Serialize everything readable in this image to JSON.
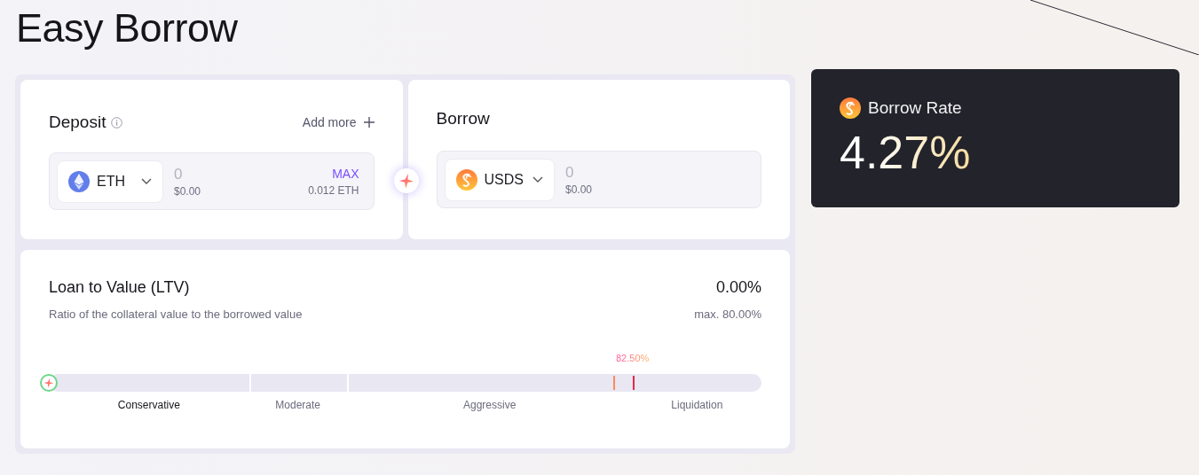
{
  "page": {
    "title": "Easy Borrow"
  },
  "deposit": {
    "title": "Deposit",
    "add_more": "Add more",
    "token": {
      "symbol": "ETH",
      "kind": "eth"
    },
    "amount": {
      "placeholder": "0"
    },
    "usd": "$0.00",
    "max": "MAX",
    "balance": "0.012 ETH"
  },
  "borrow": {
    "title": "Borrow",
    "token": {
      "symbol": "USDS",
      "kind": "usds"
    },
    "amount": {
      "placeholder": "0"
    },
    "usd": "$0.00"
  },
  "ltv": {
    "title": "Loan to Value (LTV)",
    "value": "0.00%",
    "subtitle": "Ratio of the collateral value to the borrowed value",
    "max": "max. 80.00%",
    "thumb": {
      "level": 0
    },
    "markers": [
      {
        "kind": "max",
        "level": 0.792
      },
      {
        "kind": "liquidation",
        "level": 0.819,
        "label": "82.50%"
      }
    ],
    "segments": [
      {
        "label": "Conservative",
        "selected": true
      },
      {
        "label": "Moderate",
        "selected": false
      },
      {
        "label": "Aggressive",
        "selected": false
      },
      {
        "label": "Liquidation",
        "selected": false
      }
    ]
  },
  "rate": {
    "title": "Borrow Rate",
    "value": "4.27%"
  }
}
